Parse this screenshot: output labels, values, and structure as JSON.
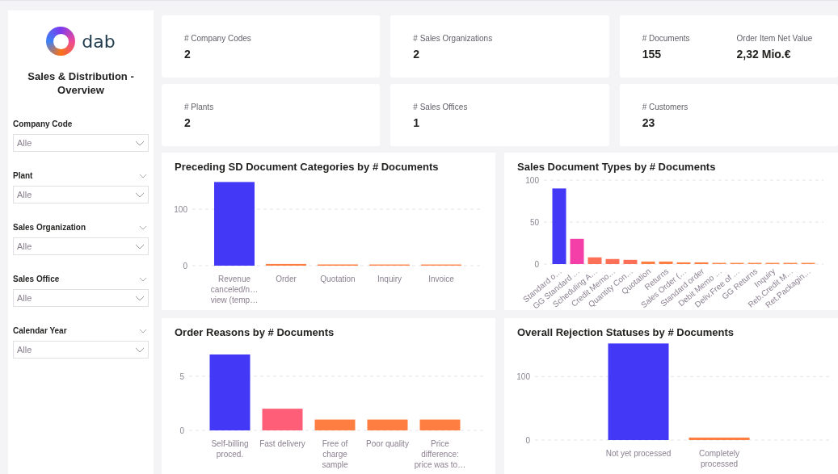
{
  "sidebar": {
    "logo_text": "dab",
    "title": "Sales & Distribution - Overview",
    "filters": [
      {
        "label": "Company Code",
        "value": "Alle",
        "collapsible": false
      },
      {
        "label": "Plant",
        "value": "Alle",
        "collapsible": true
      },
      {
        "label": "Sales Organization",
        "value": "Alle",
        "collapsible": true
      },
      {
        "label": "Sales Office",
        "value": "Alle",
        "collapsible": true
      },
      {
        "label": "Calendar Year",
        "value": "Alle",
        "collapsible": true
      }
    ]
  },
  "kpi_cards": [
    {
      "items": [
        {
          "label": "# Company Codes",
          "value": "2"
        }
      ]
    },
    {
      "items": [
        {
          "label": "# Sales Organizations",
          "value": "2"
        }
      ]
    },
    {
      "items": [
        {
          "label": "# Documents",
          "value": "155"
        },
        {
          "label": "Order Item Net Value",
          "value": "2,32 Mio.€"
        }
      ]
    },
    {
      "items": [
        {
          "label": "# Plants",
          "value": "2"
        }
      ]
    },
    {
      "items": [
        {
          "label": "# Sales Offices",
          "value": "1"
        }
      ]
    },
    {
      "items": [
        {
          "label": "# Customers",
          "value": "23"
        }
      ]
    }
  ],
  "charts": [
    {
      "chart_data": {
        "type": "bar",
        "title": "Preceding SD Document Categories by # Documents",
        "categories": [
          "Revenue canceled/n… view (temp…",
          "Order",
          "Quotation",
          "Inquiry",
          "Invoice"
        ],
        "yticks": [
          0,
          100
        ],
        "ylim": [
          0,
          150
        ],
        "series": [
          {
            "colors": [
              "#4338f5",
              "#fd7e40",
              "#fd7e40",
              "#fd8a50",
              "#fd8a50"
            ],
            "values": [
              148,
              3,
              2,
              1,
              1
            ]
          }
        ]
      }
    },
    {
      "chart_data": {
        "type": "bar",
        "title": "Sales Document Types by # Documents",
        "categories": [
          "Standard o…",
          "GG Standard …",
          "Scheduling A…",
          "Credit Memo…",
          "Quantity Con…",
          "Quotation",
          "Returns",
          "Sales Order (…",
          "Standard order",
          "Debit Memo …",
          "Deliv.Free of …",
          "GG Returns",
          "Inquiry",
          "Reb.Credit M…",
          "Ret.Packagin…"
        ],
        "yticks": [
          0,
          50,
          100
        ],
        "ylim": [
          0,
          100
        ],
        "series": [
          {
            "colors": [
              "#4338f5",
              "#f43fa8",
              "#fd7058",
              "#fd7058",
              "#fd7058",
              "#fd7e40",
              "#fd7e40",
              "#fd7e40",
              "#fd7e40",
              "#fd8a50",
              "#fd8a50",
              "#fd8a50",
              "#fd8a50",
              "#fd8a50",
              "#fd8a50"
            ],
            "values": [
              90,
              30,
              8,
              6,
              5,
              3,
              3,
              2,
              2,
              1,
              1,
              1,
              1,
              1,
              1
            ]
          }
        ]
      }
    },
    {
      "chart_data": {
        "type": "bar",
        "title": "Order Reasons by # Documents",
        "categories": [
          "Self-billing proced.",
          "Fast delivery",
          "Free of charge sample",
          "Poor quality",
          "Price difference: price was to…"
        ],
        "yticks": [
          0,
          5
        ],
        "ylim": [
          0,
          7
        ],
        "series": [
          {
            "colors": [
              "#4338f5",
              "#ff5e78",
              "#fd7e40",
              "#fd7e40",
              "#fd7e40"
            ],
            "values": [
              7,
              2,
              1,
              1,
              1
            ]
          }
        ]
      }
    },
    {
      "chart_data": {
        "type": "bar",
        "title": "Overall Rejection Statuses by # Documents",
        "categories": [
          "Not yet processed",
          "Completely processed"
        ],
        "yticks": [
          0,
          100
        ],
        "ylim": [
          0,
          155
        ],
        "series": [
          {
            "colors": [
              "#4338f5",
              "#fd7e40"
            ],
            "values": [
              152,
              4
            ]
          }
        ]
      }
    }
  ]
}
